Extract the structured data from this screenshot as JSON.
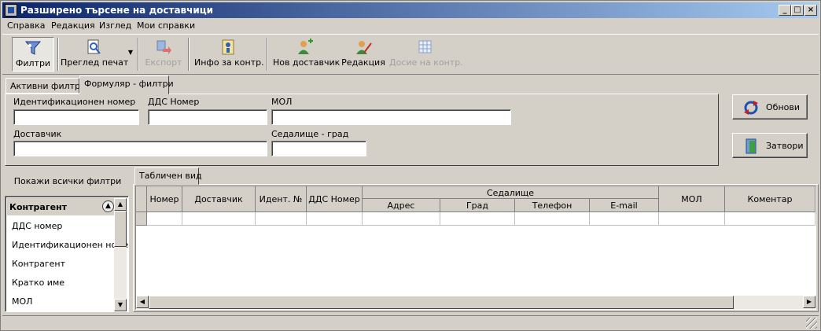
{
  "window": {
    "title": "Разширено търсене на доставчици"
  },
  "menu": [
    "Справка",
    "Редакция",
    "Изглед",
    "Мои справки"
  ],
  "toolbar": {
    "filters": "Филтри",
    "print_preview": "Преглед печат",
    "export": "Експорт",
    "contractor_info": "Инфо за контр.",
    "new_supplier": "Нов доставчик",
    "edit": "Редакция",
    "contractor_dossier": "Досие на контр."
  },
  "filter_tabs": {
    "active": "Активни филтри",
    "form": "Формуляр - филтри"
  },
  "form": {
    "id_number": {
      "label": "Идентификационен номер",
      "value": ""
    },
    "vat_number": {
      "label": "ДДС Номер",
      "value": ""
    },
    "mol": {
      "label": "МОЛ",
      "value": ""
    },
    "supplier": {
      "label": "Доставчик",
      "value": ""
    },
    "seat_city": {
      "label": "Седалище - град",
      "value": ""
    }
  },
  "buttons": {
    "refresh": "Обнови",
    "close": "Затвори"
  },
  "left_panel": {
    "show_all": "Покажи всички филтри",
    "group": "Контрагент",
    "items": [
      "ДДС номер",
      "Идентификационен номер",
      "Контрагент",
      "Кратко име",
      "МОЛ"
    ]
  },
  "grid_tab": "Табличен вид",
  "grid": {
    "columns": {
      "number": "Номер",
      "supplier": "Доставчик",
      "ident": "Идент. №",
      "vat": "ДДС Номер",
      "seat": "Седалище",
      "address": "Адрес",
      "city": "Град",
      "phone": "Телефон",
      "email": "E-mail",
      "mol": "МОЛ",
      "comment": "Коментар"
    }
  }
}
